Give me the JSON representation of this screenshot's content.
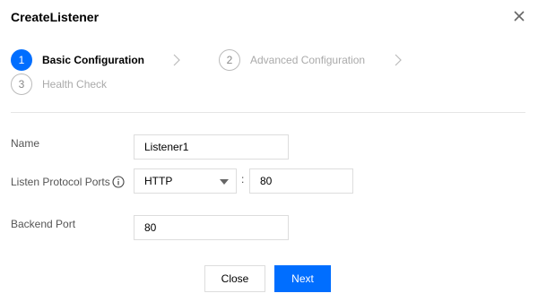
{
  "dialog": {
    "title": "CreateListener",
    "close_icon": "close-icon"
  },
  "steps": [
    {
      "number": "1",
      "label": "Basic Configuration",
      "state": "active"
    },
    {
      "number": "2",
      "label": "Advanced Configuration",
      "state": "inactive"
    },
    {
      "number": "3",
      "label": "Health Check",
      "state": "inactive"
    }
  ],
  "form": {
    "name_label": "Name",
    "name_value": "Listener1",
    "protocol_label": "Listen Protocol Ports",
    "protocol_value": "HTTP",
    "port_separator": ":",
    "port_value": "80",
    "backend_label": "Backend Port",
    "backend_value": "80"
  },
  "buttons": {
    "close_label": "Close",
    "next_label": "Next"
  },
  "colors": {
    "accent": "#006eff",
    "border": "#dddddd",
    "muted_text": "#aaaaaa"
  }
}
